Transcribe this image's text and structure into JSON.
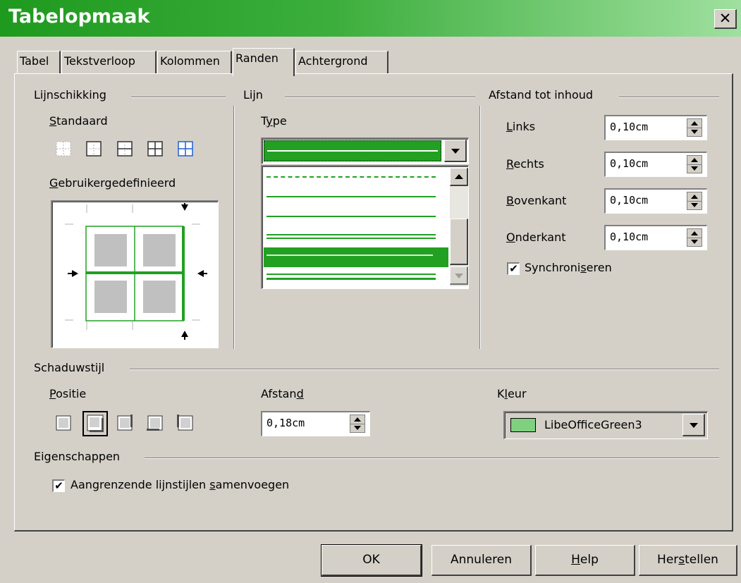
{
  "window": {
    "title": "Tabelopmaak",
    "close_label": "✕"
  },
  "tabs": [
    {
      "label": "Tabel"
    },
    {
      "label": "Tekstverloop"
    },
    {
      "label": "Kolommen"
    },
    {
      "label": "Randen",
      "active": true
    },
    {
      "label": "Achtergrond"
    }
  ],
  "line_arrangement": {
    "title": "Lijnschikking",
    "default_label_prefix": "S",
    "default_label_rest": "tandaard",
    "custom_label_prefix": "G",
    "custom_label_rest": "ebruikergedefinieerd",
    "presets": [
      "no-borders-icon",
      "outer-border-icon",
      "outer-horizontal-icon",
      "outer-all-inner-icon",
      "outer-only-inner-icon"
    ]
  },
  "line": {
    "title": "Lijn",
    "type_label_prefix": "T",
    "type_label_underlined": "y",
    "type_label_rest": "pe",
    "line_styles": [
      "dashed",
      "thin",
      "thin",
      "double-thin",
      "double-thick-selected",
      "double-thin"
    ]
  },
  "spacing": {
    "title": "Afstand tot inhoud",
    "fields": [
      {
        "label_u": "L",
        "label_rest": "inks",
        "value": "0,10cm"
      },
      {
        "label_u": "R",
        "label_rest": "echts",
        "value": "0,10cm"
      },
      {
        "label_u": "B",
        "label_rest": "ovenkant",
        "value": "0,10cm"
      },
      {
        "label_u": "O",
        "label_rest": "nderkant",
        "value": "0,10cm"
      }
    ],
    "sync_label_a": "Synchroni",
    "sync_label_u": "s",
    "sync_label_b": "eren",
    "sync_checked": "✔"
  },
  "shadow": {
    "title": "Schaduwstijl",
    "position_label_u": "P",
    "position_label_rest": "ositie",
    "distance_label_a": "Afstan",
    "distance_label_u": "d",
    "distance_value": "0,18cm",
    "color_label_a": "K",
    "color_label_u": "l",
    "color_label_b": "eur",
    "color_value": "LibeOfficeGreen3",
    "color_swatch": "#7fd17f"
  },
  "properties": {
    "title": "Eigenschappen",
    "merge_label_a": "Aangrenzende lijnstijlen ",
    "merge_label_u": "s",
    "merge_label_b": "amenvoegen",
    "merge_checked": "✔"
  },
  "buttons": {
    "ok": "OK",
    "cancel": "Annuleren",
    "help_u": "H",
    "help_rest": "elp",
    "reset_a": "Her",
    "reset_u": "s",
    "reset_b": "tellen"
  },
  "colors": {
    "accent": "#22a022",
    "title_gradient_start": "#1e9a1e",
    "title_gradient_end": "#9fe09f",
    "face": "#d4d0c8"
  }
}
